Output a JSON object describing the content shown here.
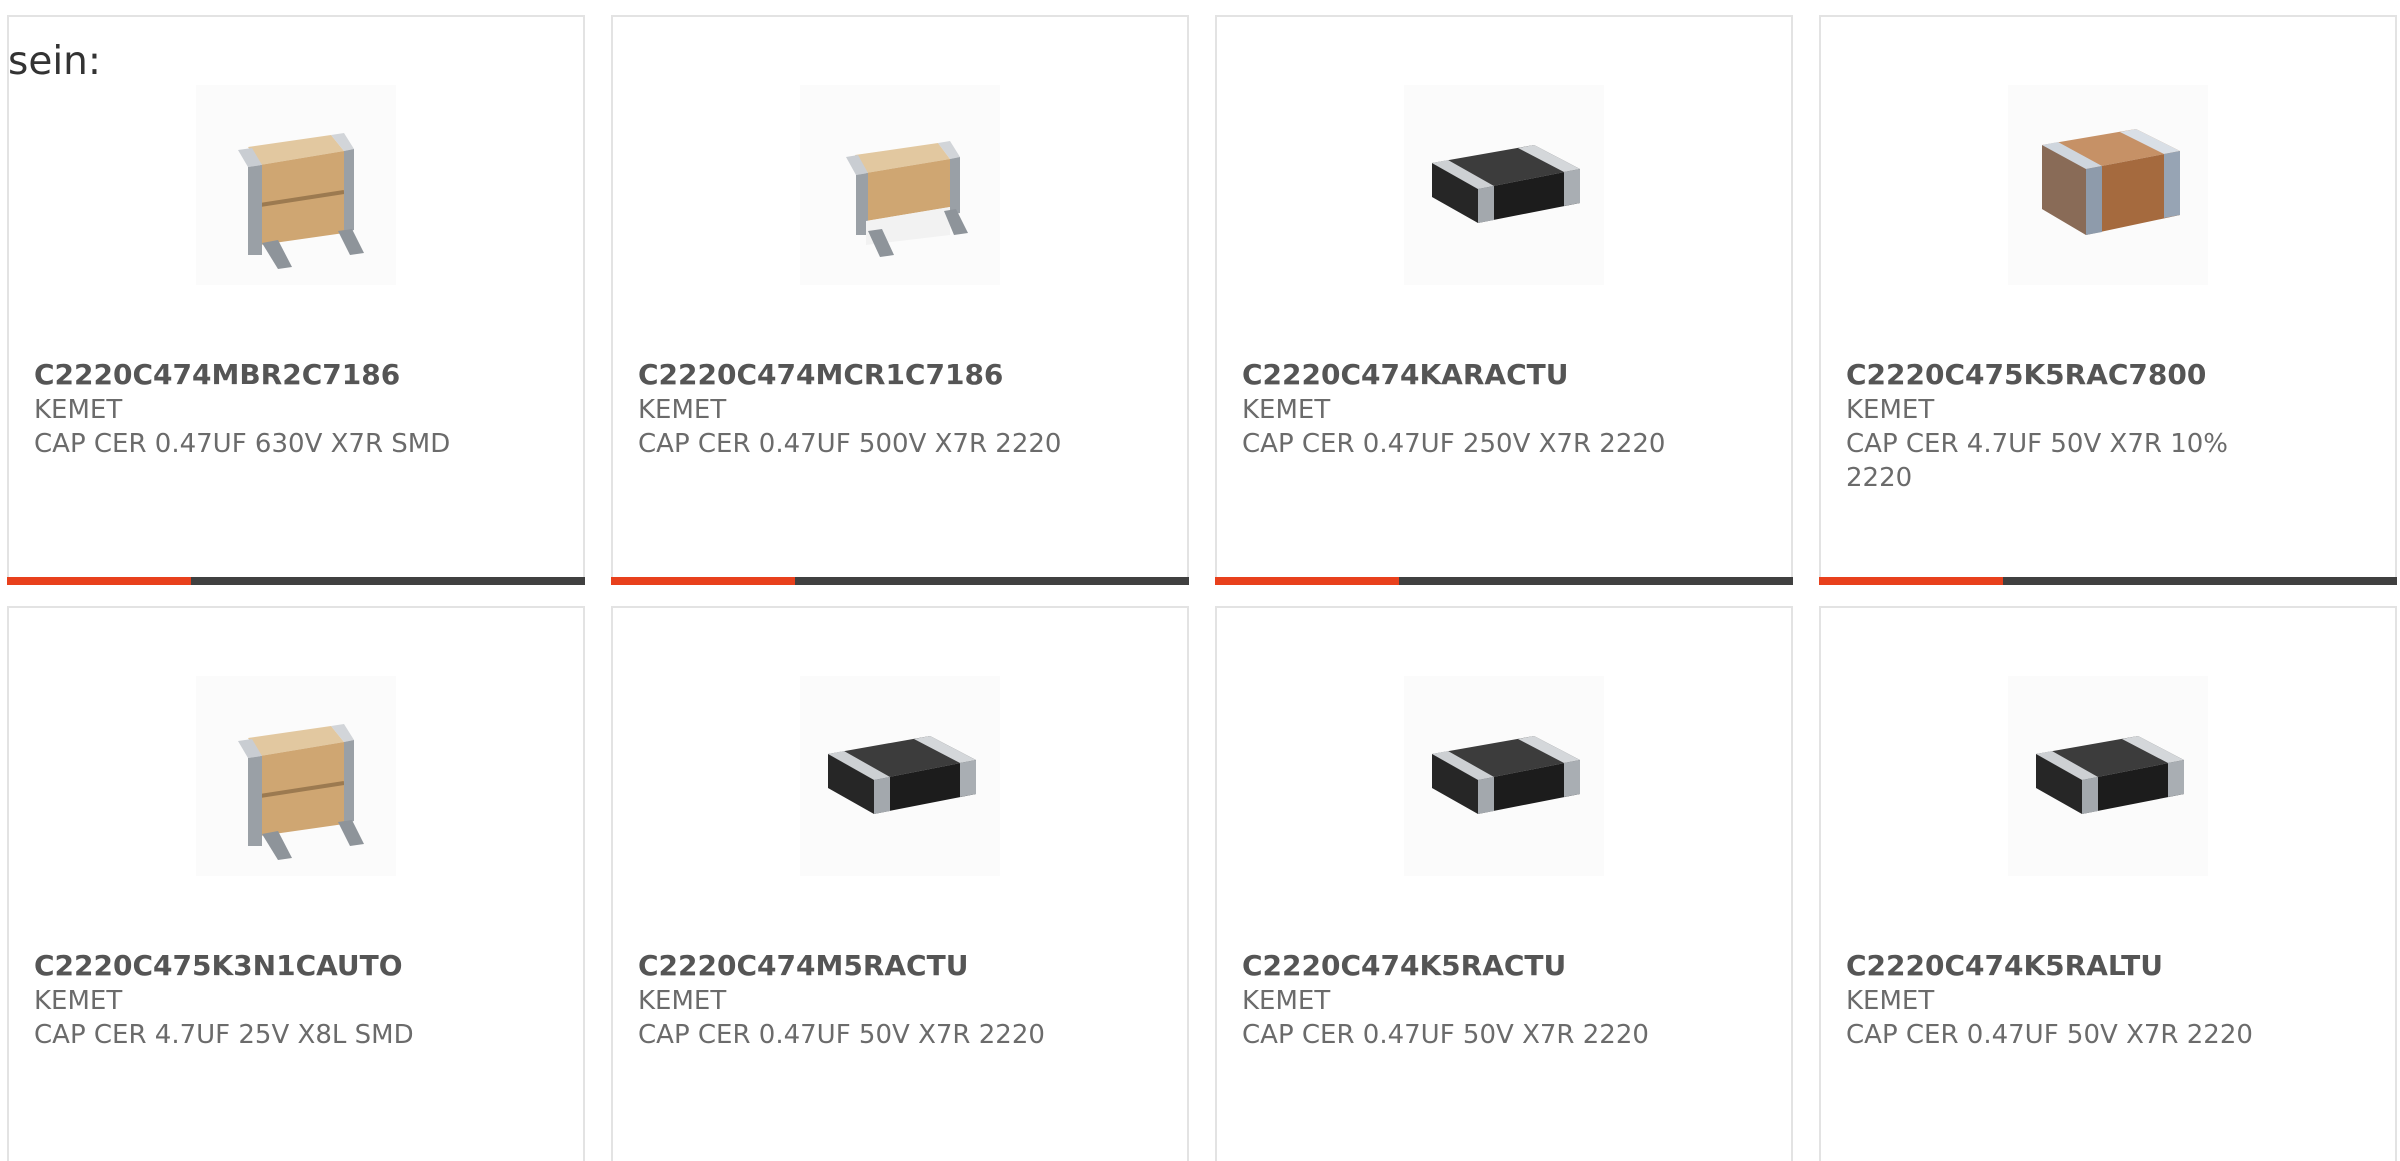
{
  "intro": {
    "text": "sein:"
  },
  "colors": {
    "accent": "#e8401c",
    "bar": "#404040",
    "card_border": "#e3e3e3",
    "part_number": "#555555",
    "body_text": "#6b6b6b"
  },
  "products": [
    {
      "part_number": "C2220C474MBR2C7186",
      "manufacturer": "KEMET",
      "description": "CAP CER 0.47UF 630V X7R SMD",
      "image_icon": "stacked-capacitor-icon"
    },
    {
      "part_number": "C2220C474MCR1C7186",
      "manufacturer": "KEMET",
      "description": "CAP CER 0.47UF 500V X7R 2220",
      "image_icon": "leaded-capacitor-icon"
    },
    {
      "part_number": "C2220C474KARACTU",
      "manufacturer": "KEMET",
      "description": "CAP CER 0.47UF 250V X7R 2220",
      "image_icon": "black-chip-capacitor-icon"
    },
    {
      "part_number": "C2220C475K5RAC7800",
      "manufacturer": "KEMET",
      "description": "CAP CER 4.7UF 50V X7R 10% 2220",
      "image_icon": "brown-chip-capacitor-icon"
    },
    {
      "part_number": "C2220C475K3N1CAUTO",
      "manufacturer": "KEMET",
      "description": "CAP CER 4.7UF 25V X8L SMD",
      "image_icon": "stacked-capacitor-icon"
    },
    {
      "part_number": "C2220C474M5RACTU",
      "manufacturer": "KEMET",
      "description": "CAP CER 0.47UF 50V X7R 2220",
      "image_icon": "black-chip-capacitor-icon"
    },
    {
      "part_number": "C2220C474K5RACTU",
      "manufacturer": "KEMET",
      "description": "CAP CER 0.47UF 50V X7R 2220",
      "image_icon": "black-chip-capacitor-icon"
    },
    {
      "part_number": "C2220C474K5RALTU",
      "manufacturer": "KEMET",
      "description": "CAP CER 0.47UF 50V X7R 2220",
      "image_icon": "black-chip-capacitor-icon"
    }
  ]
}
